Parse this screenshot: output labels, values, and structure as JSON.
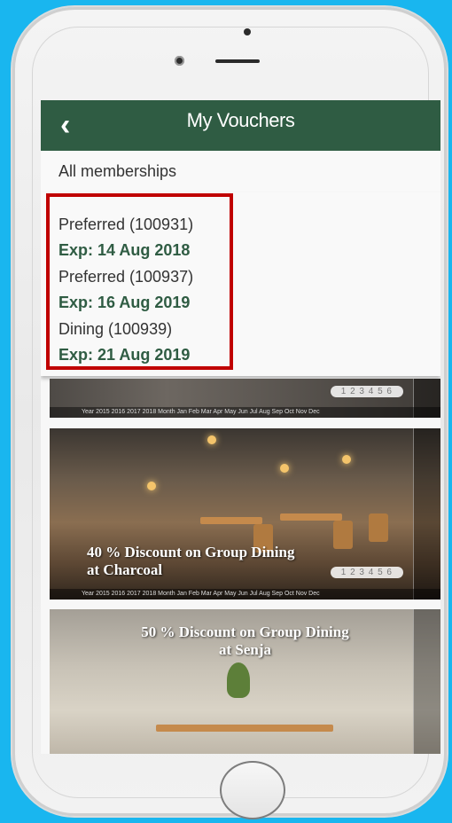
{
  "nav": {
    "back_icon": "chevron-left-icon",
    "back_glyph": "‹",
    "title": "My Vouchers"
  },
  "filter": {
    "label": "All memberships"
  },
  "memberships": [
    {
      "name": "Preferred (100931)",
      "exp": "Exp: 14 Aug 2018"
    },
    {
      "name": "Preferred (100937)",
      "exp": "Exp: 16 Aug 2019"
    },
    {
      "name": "Dining (100939)",
      "exp": "Exp: 21 Aug 2019"
    }
  ],
  "vouchers": [
    {
      "caption": "",
      "pages": "1 2 3 4 5 6"
    },
    {
      "caption_line1": "40 % Discount on Group Dining",
      "caption_line2": "at Charcoal",
      "pages": "1 2 3 4 5 6"
    },
    {
      "caption_line1": "50 % Discount on Group Dining",
      "caption_line2": "at Senja"
    }
  ],
  "timeline": {
    "text": "Year  2015 2016 2017 2018  Month  Jan  Feb  Mar  Apr  May  Jun  Jul  Aug  Sep  Oct  Nov  Dec"
  },
  "colors": {
    "brand_green": "#2f5c43",
    "highlight_red": "#c00000",
    "background": "#19b6ef"
  }
}
